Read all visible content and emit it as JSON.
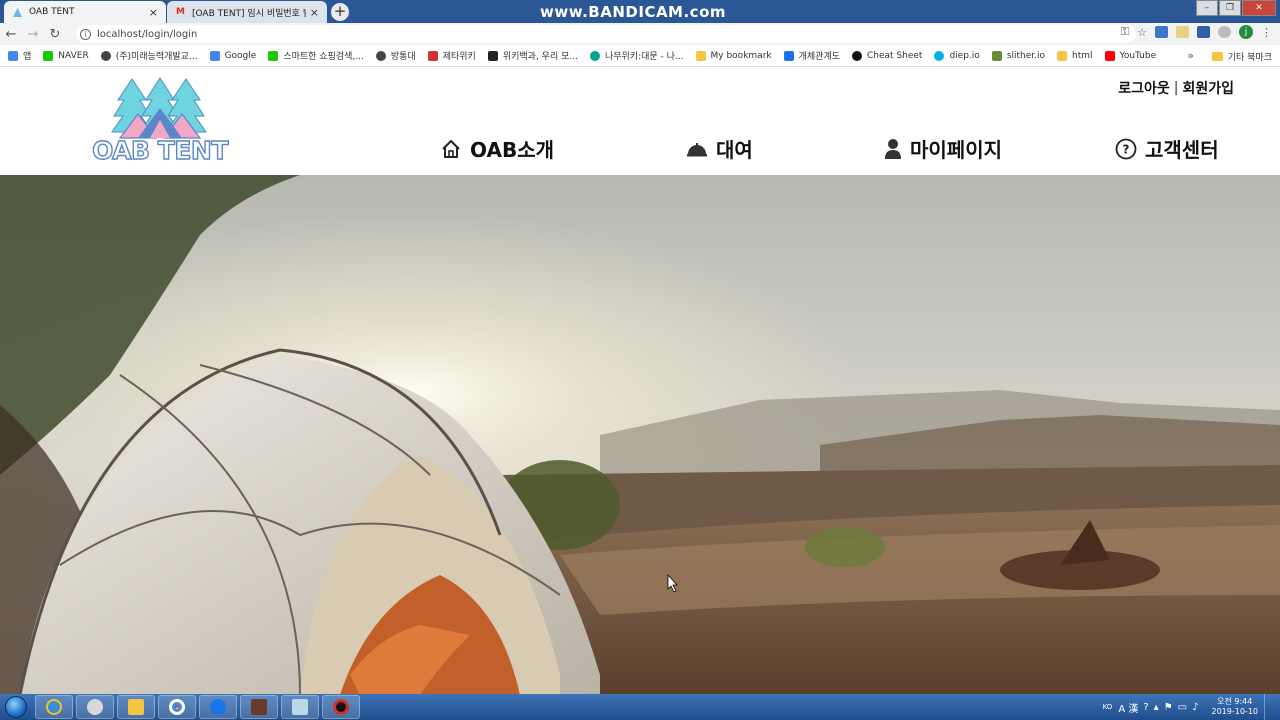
{
  "browser": {
    "tabs": [
      {
        "label": "OAB TENT",
        "active": true
      },
      {
        "label": "[OAB TENT] 임시 비밀번호 발급",
        "active": false
      }
    ],
    "recording_watermark": "www.BANDICAM.com",
    "url": "localhost/login/login",
    "bookmarks": [
      {
        "label": "앱",
        "icon": "apps-icon",
        "color": "#4285f4"
      },
      {
        "label": "NAVER",
        "icon": "naver-icon",
        "color": "#1ec800"
      },
      {
        "label": "(주)미래능력개발교...",
        "icon": "globe-icon",
        "color": "#444444"
      },
      {
        "label": "Google",
        "icon": "google-icon",
        "color": "#4285f4"
      },
      {
        "label": "스마트한 쇼핑검색,...",
        "icon": "shopping-icon",
        "color": "#1ec800"
      },
      {
        "label": "방통대",
        "icon": "globe-icon",
        "color": "#444444"
      },
      {
        "label": "제타위키",
        "icon": "zetawiki-icon",
        "color": "#d0342c"
      },
      {
        "label": "위키백과, 우리 모...",
        "icon": "wikipedia-icon",
        "color": "#222222"
      },
      {
        "label": "나무위키:대문 - 나...",
        "icon": "namuwiki-icon",
        "color": "#00a495"
      },
      {
        "label": "My bookmark",
        "icon": "folder-icon",
        "color": "#f4c542"
      },
      {
        "label": "개체관계도",
        "icon": "diagram-icon",
        "color": "#1a73e8"
      },
      {
        "label": "Cheat Sheet",
        "icon": "github-icon",
        "color": "#111111"
      },
      {
        "label": "diep.io",
        "icon": "diep-icon",
        "color": "#00b2e1"
      },
      {
        "label": "slither.io",
        "icon": "slither-icon",
        "color": "#6a8c3c"
      },
      {
        "label": "html",
        "icon": "folder-icon",
        "color": "#f4c542"
      },
      {
        "label": "YouTube",
        "icon": "youtube-icon",
        "color": "#ff0000"
      }
    ],
    "other_bookmarks": "기타 북마크",
    "profile_initial": "j"
  },
  "site": {
    "logo_text": "OAB TENT",
    "auth": {
      "logout": "로그아웃",
      "separator": "|",
      "signup": "회원가입"
    },
    "nav": [
      {
        "label": "OAB소개",
        "icon": "home-icon"
      },
      {
        "label": "대여",
        "icon": "service-bell-icon"
      },
      {
        "label": "마이페이지",
        "icon": "user-icon"
      },
      {
        "label": "고객센터",
        "icon": "help-circle-icon"
      }
    ]
  },
  "taskbar": {
    "tray_lang": "KO",
    "tray_ime": "A 漢",
    "clock_time": "오전 9:44",
    "clock_date": "2019-10-10"
  },
  "colors": {
    "tab_strip": "#2b5797",
    "logo_outline": "#5b86c9",
    "tree": "#6fd3e0",
    "tent_pink": "#f2a7c6"
  }
}
